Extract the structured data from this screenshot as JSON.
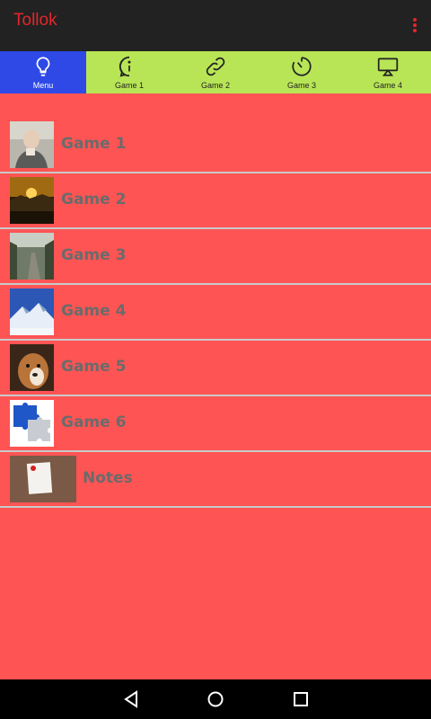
{
  "app": {
    "title": "Tollok"
  },
  "tabs": [
    {
      "label": "Menu",
      "icon": "lightbulb-icon",
      "active": true
    },
    {
      "label": "Game 1",
      "icon": "info-icon",
      "active": false
    },
    {
      "label": "Game 2",
      "icon": "link-icon",
      "active": false
    },
    {
      "label": "Game 3",
      "icon": "timer-icon",
      "active": false
    },
    {
      "label": "Game 4",
      "icon": "cast-icon",
      "active": false
    }
  ],
  "list": [
    {
      "label": "Game 1",
      "thumb": "portrait-photo"
    },
    {
      "label": "Game 2",
      "thumb": "sunset-photo"
    },
    {
      "label": "Game 3",
      "thumb": "forest-path-photo"
    },
    {
      "label": "Game 4",
      "thumb": "snowy-mountain-photo"
    },
    {
      "label": "Game 5",
      "thumb": "dog-photo"
    },
    {
      "label": "Game 6",
      "thumb": "puzzle-pieces-photo"
    },
    {
      "label": "Notes",
      "thumb": "notepad-photo"
    }
  ],
  "colors": {
    "app_bar": "#222222",
    "title": "#e3262b",
    "tab_bar": "#b8e556",
    "tab_active": "#2f49e6",
    "content": "#ff5454",
    "divider": "#c9c9c9",
    "item_text": "#6b6b6b"
  },
  "nav": {
    "icons": [
      "back-icon",
      "home-icon",
      "recents-icon"
    ]
  }
}
